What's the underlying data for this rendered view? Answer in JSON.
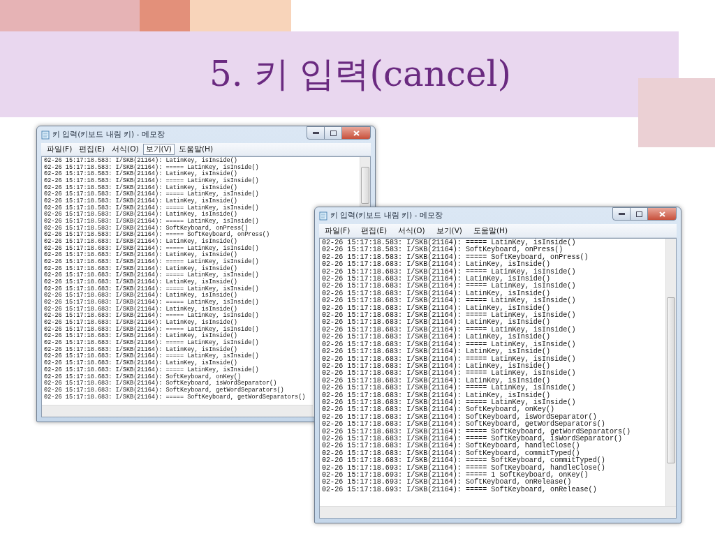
{
  "slide": {
    "title": "5. 키 입력(cancel)"
  },
  "windows": [
    {
      "title": "키 입력(키보드 내림 키) - 메모장",
      "menu": [
        {
          "label": "파일(F)",
          "selected": false
        },
        {
          "label": "편집(E)",
          "selected": false
        },
        {
          "label": "서식(O)",
          "selected": false
        },
        {
          "label": "보기(V)",
          "selected": true
        },
        {
          "label": "도움말(H)",
          "selected": false
        }
      ],
      "lines": [
        "02-26 15:17:18.583: I/SKB(21164): LatinKey, isInside()",
        "02-26 15:17:18.583: I/SKB(21164): ===== LatinKey, isInside()",
        "02-26 15:17:18.583: I/SKB(21164): LatinKey, isInside()",
        "02-26 15:17:18.583: I/SKB(21164): ===== LatinKey, isInside()",
        "02-26 15:17:18.583: I/SKB(21164): LatinKey, isInside()",
        "02-26 15:17:18.583: I/SKB(21164): ===== LatinKey, isInside()",
        "02-26 15:17:18.583: I/SKB(21164): LatinKey, isInside()",
        "02-26 15:17:18.583: I/SKB(21164): ===== LatinKey, isInside()",
        "02-26 15:17:18.583: I/SKB(21164): LatinKey, isInside()",
        "02-26 15:17:18.583: I/SKB(21164): ===== LatinKey, isInside()",
        "02-26 15:17:18.583: I/SKB(21164): SoftKeyboard, onPress()",
        "02-26 15:17:18.583: I/SKB(21164): ===== SoftKeyboard, onPress()",
        "02-26 15:17:18.683: I/SKB(21164): LatinKey, isInside()",
        "02-26 15:17:18.683: I/SKB(21164): ===== LatinKey, isInside()",
        "02-26 15:17:18.683: I/SKB(21164): LatinKey, isInside()",
        "02-26 15:17:18.683: I/SKB(21164): ===== LatinKey, isInside()",
        "02-26 15:17:18.683: I/SKB(21164): LatinKey, isInside()",
        "02-26 15:17:18.683: I/SKB(21164): ===== LatinKey, isInside()",
        "02-26 15:17:18.683: I/SKB(21164): LatinKey, isInside()",
        "02-26 15:17:18.683: I/SKB(21164): ===== LatinKey, isInside()",
        "02-26 15:17:18.683: I/SKB(21164): LatinKey, isInside()",
        "02-26 15:17:18.683: I/SKB(21164): ===== LatinKey, isInside()",
        "02-26 15:17:18.683: I/SKB(21164): LatinKey, isInside()",
        "02-26 15:17:18.683: I/SKB(21164): ===== LatinKey, isInside()",
        "02-26 15:17:18.683: I/SKB(21164): LatinKey, isInside()",
        "02-26 15:17:18.683: I/SKB(21164): ===== LatinKey, isInside()",
        "02-26 15:17:18.683: I/SKB(21164): LatinKey, isInside()",
        "02-26 15:17:18.683: I/SKB(21164): ===== LatinKey, isInside()",
        "02-26 15:17:18.683: I/SKB(21164): LatinKey, isInside()",
        "02-26 15:17:18.683: I/SKB(21164): ===== LatinKey, isInside()",
        "02-26 15:17:18.683: I/SKB(21164): LatinKey, isInside()",
        "02-26 15:17:18.683: I/SKB(21164): ===== LatinKey, isInside()",
        "02-26 15:17:18.683: I/SKB(21164): SoftKeyboard, onKey()",
        "02-26 15:17:18.683: I/SKB(21164): SoftKeyboard, isWordSeparator()",
        "02-26 15:17:18.683: I/SKB(21164): SoftKeyboard, getWordSeparators()",
        "02-26 15:17:18.683: I/SKB(21164): ===== SoftKeyboard, getWordSeparators()"
      ]
    },
    {
      "title": "키 입력(키보드 내림 키) - 메모장",
      "menu": [
        {
          "label": "파일(F)",
          "selected": false
        },
        {
          "label": "편집(E)",
          "selected": false
        },
        {
          "label": "서식(O)",
          "selected": false
        },
        {
          "label": "보기(V)",
          "selected": false
        },
        {
          "label": "도움말(H)",
          "selected": false
        }
      ],
      "lines": [
        "02-26 15:17:18.583: I/SKB(21164): ===== LatinKey, isInside()",
        "02-26 15:17:18.583: I/SKB(21164): SoftKeyboard, onPress()",
        "02-26 15:17:18.583: I/SKB(21164): ===== SoftKeyboard, onPress()",
        "02-26 15:17:18.683: I/SKB(21164): LatinKey, isInside()",
        "02-26 15:17:18.683: I/SKB(21164): ===== LatinKey, isInside()",
        "02-26 15:17:18.683: I/SKB(21164): LatinKey, isInside()",
        "02-26 15:17:18.683: I/SKB(21164): ===== LatinKey, isInside()",
        "02-26 15:17:18.683: I/SKB(21164): LatinKey, isInside()",
        "02-26 15:17:18.683: I/SKB(21164): ===== LatinKey, isInside()",
        "02-26 15:17:18.683: I/SKB(21164): LatinKey, isInside()",
        "02-26 15:17:18.683: I/SKB(21164): ===== LatinKey, isInside()",
        "02-26 15:17:18.683: I/SKB(21164): LatinKey, isInside()",
        "02-26 15:17:18.683: I/SKB(21164): ===== LatinKey, isInside()",
        "02-26 15:17:18.683: I/SKB(21164): LatinKey, isInside()",
        "02-26 15:17:18.683: I/SKB(21164): ===== LatinKey, isInside()",
        "02-26 15:17:18.683: I/SKB(21164): LatinKey, isInside()",
        "02-26 15:17:18.683: I/SKB(21164): ===== LatinKey, isInside()",
        "02-26 15:17:18.683: I/SKB(21164): LatinKey, isInside()",
        "02-26 15:17:18.683: I/SKB(21164): ===== LatinKey, isInside()",
        "02-26 15:17:18.683: I/SKB(21164): LatinKey, isInside()",
        "02-26 15:17:18.683: I/SKB(21164): ===== LatinKey, isInside()",
        "02-26 15:17:18.683: I/SKB(21164): LatinKey, isInside()",
        "02-26 15:17:18.683: I/SKB(21164): ===== LatinKey, isInside()",
        "02-26 15:17:18.683: I/SKB(21164): SoftKeyboard, onKey()",
        "02-26 15:17:18.683: I/SKB(21164): SoftKeyboard, isWordSeparator()",
        "02-26 15:17:18.683: I/SKB(21164): SoftKeyboard, getWordSeparators()",
        "02-26 15:17:18.683: I/SKB(21164): ===== SoftKeyboard, getWordSeparators()",
        "02-26 15:17:18.683: I/SKB(21164): ===== SoftKeyboard, isWordSeparator()",
        "02-26 15:17:18.683: I/SKB(21164): SoftKeyboard, handleClose()",
        "02-26 15:17:18.683: I/SKB(21164): SoftKeyboard, commitTyped()",
        "02-26 15:17:18.683: I/SKB(21164): ===== SoftKeyboard, commitTyped()",
        "02-26 15:17:18.693: I/SKB(21164): ===== SoftKeyboard, handleClose()",
        "02-26 15:17:18.693: I/SKB(21164): ===== 1 SoftKeyboard, onKey()",
        "02-26 15:17:18.693: I/SKB(21164): SoftKeyboard, onRelease()",
        "02-26 15:17:18.693: I/SKB(21164): ===== SoftKeyboard, onRelease()"
      ]
    }
  ]
}
